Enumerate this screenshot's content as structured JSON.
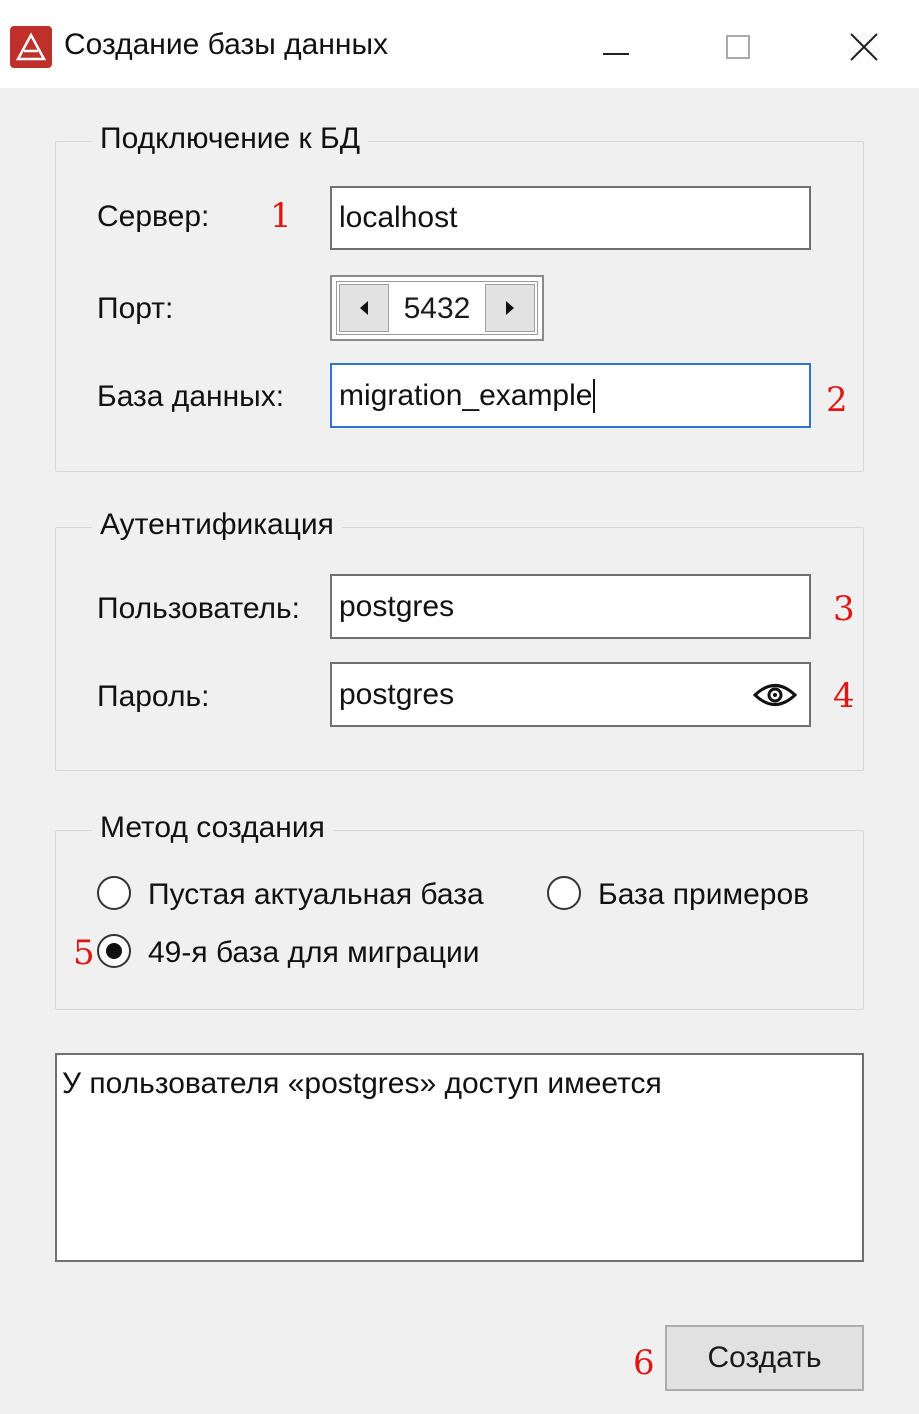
{
  "window": {
    "title": "Создание базы данных",
    "accent": "#c0302a",
    "app_icon": "app-logo-icon",
    "controls": [
      "minimize-icon",
      "maximize-icon",
      "close-icon"
    ]
  },
  "connection": {
    "legend": "Подключение к БД",
    "server_label": "Сервер:",
    "server_value": "localhost",
    "port_label": "Порт:",
    "port_value": "5432",
    "database_label": "База данных:",
    "database_value": "migration_example"
  },
  "auth": {
    "legend": "Аутентификация",
    "user_label": "Пользователь:",
    "user_value": "postgres",
    "password_label": "Пароль:",
    "password_value": "postgres",
    "password_toggle_icon": "eye-icon"
  },
  "method": {
    "legend": "Метод создания",
    "options": [
      {
        "label": "Пустая актуальная база",
        "checked": false
      },
      {
        "label": "База примеров",
        "checked": false
      },
      {
        "label": "49-я база для миграции",
        "checked": true
      }
    ]
  },
  "status": {
    "text": "У пользователя «postgres» доступ имеется"
  },
  "actions": {
    "create_label": "Создать"
  },
  "markers": [
    "1",
    "2",
    "3",
    "4",
    "5",
    "6"
  ],
  "colors": {
    "marker": "#e01515",
    "focus_border": "#2f74d0"
  }
}
